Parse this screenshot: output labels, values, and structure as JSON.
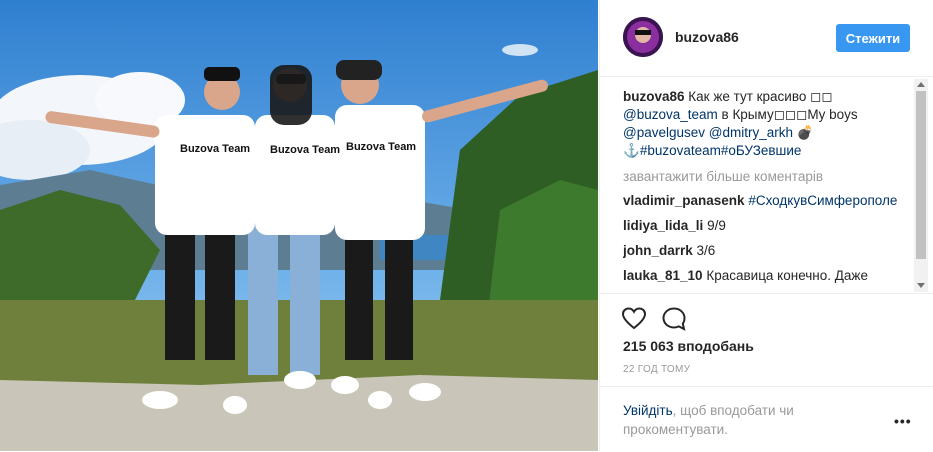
{
  "post": {
    "username": "buzova86",
    "follow_label": "Стежити",
    "caption_user": "buzova86",
    "caption_text": "Как же тут красиво ",
    "caption_emoji": "◻◻",
    "caption_mention_1": "@buzova_team",
    "caption_mid": " в Крыму",
    "caption_emoji_2": "◻◻◻",
    "caption_boys": "My boys",
    "caption_mention_2": "@pavelgusev",
    "caption_mention_3": "@dmitry_arkh",
    "caption_emoji_3": "💣",
    "caption_anchor": "⚓",
    "caption_tags": "#buzovateam#оБУЗевшие",
    "load_more": "завантажити більше коментарів",
    "comments": [
      {
        "user": "vladimir_panasenk",
        "text": "#СходкувСимферополе"
      },
      {
        "user": "lidiya_lida_li",
        "text": "9/9"
      },
      {
        "user": "john_darrk",
        "text": "3/6"
      },
      {
        "user": "lauka_81_10",
        "text": "Красавица конечно. Даже"
      }
    ],
    "likes": "215 063 вподобань",
    "time": "22 ГОД ТОМУ",
    "login_link": "Увійдіть",
    "login_rest": ", щоб вподобати чи прокоментувати.",
    "more_label": "•••"
  },
  "icons": {
    "like": "heart-outline-icon",
    "comment": "speech-bubble-icon",
    "more": "ellipsis-icon"
  },
  "colors": {
    "accent": "#3897f0",
    "link": "#003569",
    "muted": "#999999"
  }
}
